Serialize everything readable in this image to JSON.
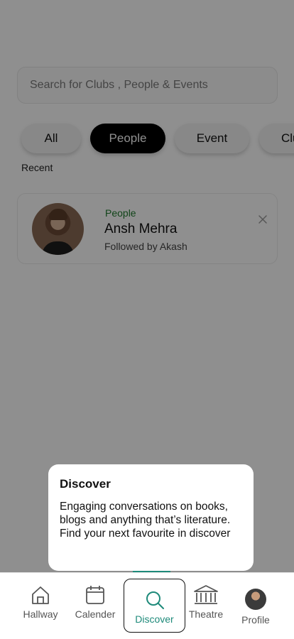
{
  "search": {
    "placeholder": "Search for Clubs , People & Events"
  },
  "filters": {
    "all": "All",
    "people": "People",
    "event": "Event",
    "clubs": "Clubs"
  },
  "recent": {
    "label": "Recent",
    "items": [
      {
        "tag": "People",
        "name": "Ansh Mehra",
        "subtitle": "Followed by Akash"
      }
    ]
  },
  "tooltip": {
    "title": "Discover",
    "body": "Engaging conversations on books, blogs and anything that’s literature. Find your next favourite in discover"
  },
  "nav": {
    "hallway": "Hallway",
    "calender": "Calender",
    "discover": "Discover",
    "theatre": "Theatre",
    "profile": "Profile"
  },
  "colors": {
    "accent": "#1e8a7a",
    "tag_green": "#1f7a2e",
    "active_chip": "#000000"
  }
}
